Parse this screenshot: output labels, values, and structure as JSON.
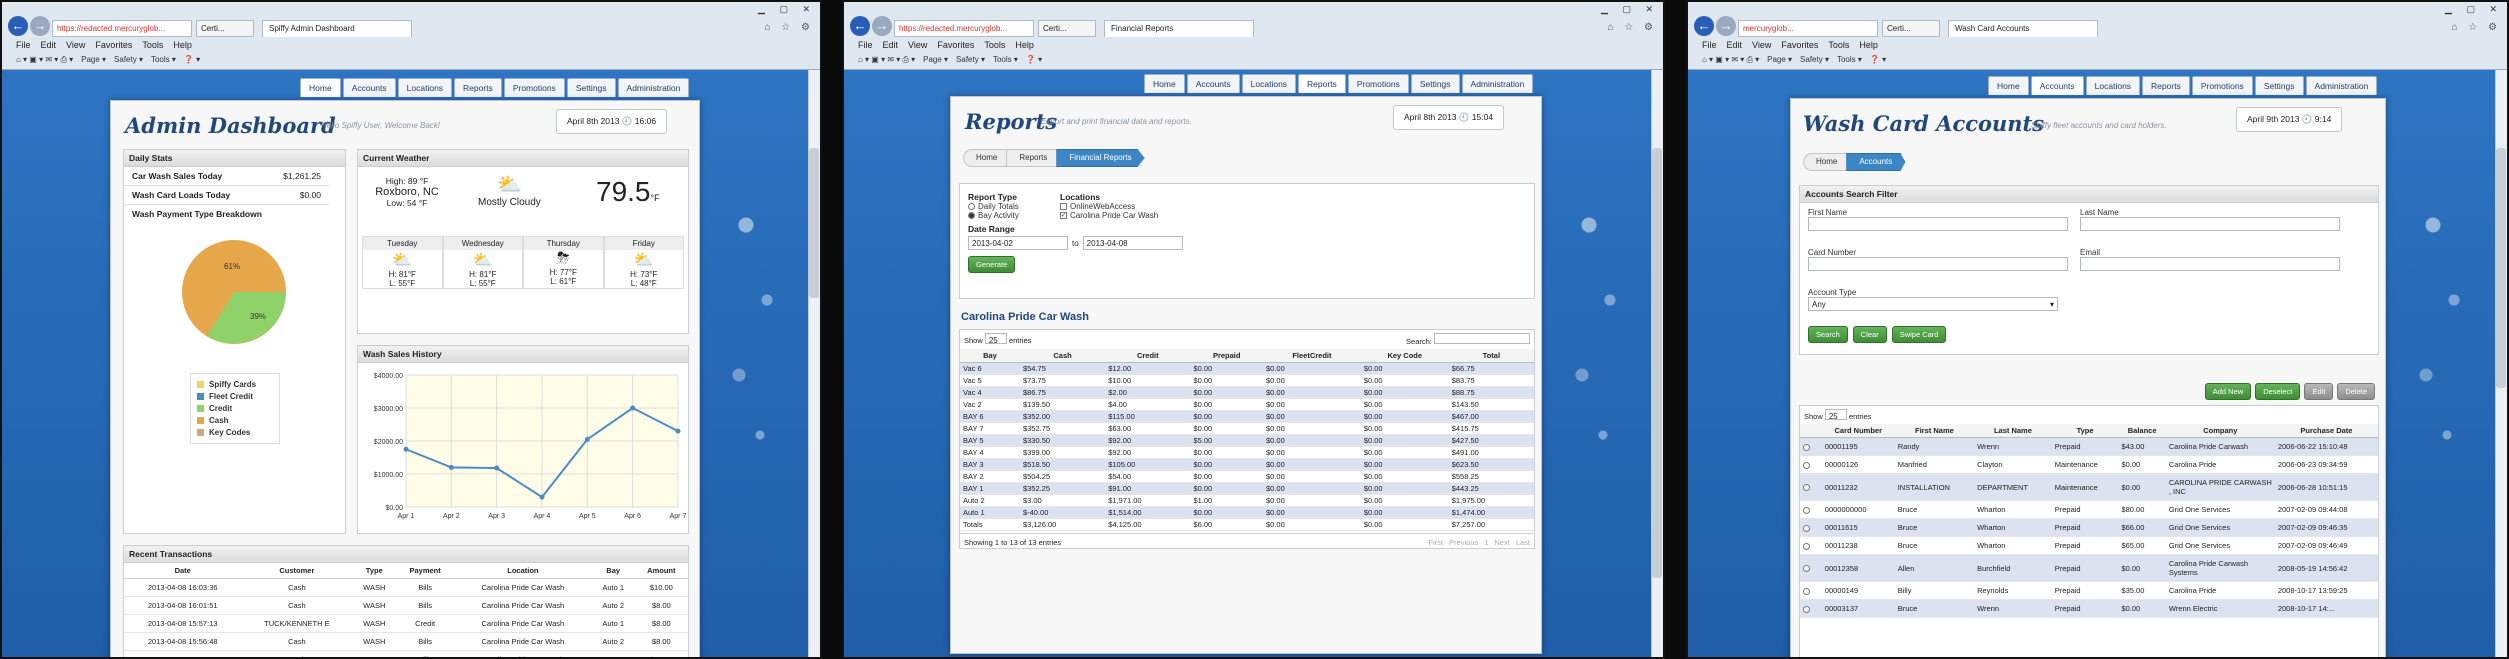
{
  "colors": {
    "accent": "#3d86c6",
    "green": "#4f9f45",
    "blue": "#4a8bc2"
  },
  "browser": {
    "w1": {
      "url": "https://redacted.mercuryglob...",
      "cert": "Certi...",
      "tab": "Spiffy Admin Dashboard"
    },
    "w2": {
      "url": "https://redacted.mercuryglob...",
      "cert": "Certi...",
      "tab": "Financial Reports"
    },
    "w3": {
      "url": "mercuryglob...",
      "cert": "Certi...",
      "tab": "Wash Card Accounts"
    },
    "menu": [
      "File",
      "Edit",
      "View",
      "Favorites",
      "Tools",
      "Help"
    ],
    "cmd": [
      "Page ▾",
      "Safety ▾",
      "Tools ▾",
      "❓ ▾"
    ]
  },
  "nav": [
    "Home",
    "Accounts",
    "Locations",
    "Reports",
    "Promotions",
    "Settings",
    "Administration"
  ],
  "dashboard": {
    "title": "Admin Dashboard",
    "subtitle": "Hello Spiffy User, Welcome Back!",
    "date": "April 8th 2013",
    "time": "16:06",
    "daily": {
      "header": "Daily Stats",
      "rows": [
        {
          "label": "Car Wash Sales Today",
          "value": "$1,261.25"
        },
        {
          "label": "Wash Card Loads Today",
          "value": "$0.00"
        }
      ],
      "breakdown": "Wash Payment Type Breakdown"
    },
    "pie": {
      "label_a": "61%",
      "label_b": "39%"
    },
    "legend": [
      "Spiffy Cards",
      "Fleet Credit",
      "Credit",
      "Cash",
      "Key Codes"
    ],
    "weather": {
      "header": "Current Weather",
      "high": "High: 89 °F",
      "city": "Roxboro, NC",
      "low": "Low: 54 °F",
      "cond": "Mostly Cloudy",
      "temp": "79.5",
      "unit": "°F",
      "days": [
        {
          "d": "Tuesday",
          "h": "H: 81°F",
          "l": "L: 55°F"
        },
        {
          "d": "Wednesday",
          "h": "H: 81°F",
          "l": "L: 55°F"
        },
        {
          "d": "Thursday",
          "h": "H: 77°F",
          "l": "L: 61°F"
        },
        {
          "d": "Friday",
          "h": "H: 73°F",
          "l": "L: 48°F"
        }
      ]
    },
    "history_header": "Wash Sales History",
    "tx": {
      "header": "Recent Transactions",
      "cols": [
        "Date",
        "Customer",
        "Type",
        "Payment",
        "Location",
        "Bay",
        "Amount"
      ],
      "rows": [
        [
          "2013-04-08 16:03:36",
          "Cash",
          "WASH",
          "Bills",
          "Carolina Pride Car Wash",
          "Auto 1",
          "$10.00"
        ],
        [
          "2013-04-08 16:01:51",
          "Cash",
          "WASH",
          "Bills",
          "Carolina Pride Car Wash",
          "Auto 2",
          "$8.00"
        ],
        [
          "2013-04-08 15:57:13",
          "TUCK/KENNETH E",
          "WASH",
          "Credit",
          "Carolina Pride Car Wash",
          "Auto 1",
          "$8.00"
        ],
        [
          "2013-04-08 15:56:48",
          "Cash",
          "WASH",
          "Bills",
          "Carolina Pride Car Wash",
          "Auto 2",
          "$8.00"
        ],
        [
          "2013-04-08 15:55:17",
          "Cash",
          "WASH",
          "Bills",
          "Carolina Pride Car Wash",
          "Auto 1",
          "$10.00"
        ]
      ]
    }
  },
  "chart_data": {
    "type": "line",
    "title": "Wash Sales History",
    "x": [
      "Apr 1",
      "Apr 2",
      "Apr 3",
      "Apr 4",
      "Apr 5",
      "Apr 6",
      "Apr 7"
    ],
    "values": [
      1750,
      1200,
      1180,
      300,
      2050,
      3000,
      2300
    ],
    "ylim": [
      0,
      4000
    ],
    "yticks": [
      "$0.00",
      "$1000.00",
      "$2000.00",
      "$3000.00",
      "$4000.00"
    ]
  },
  "reports": {
    "title": "Reports",
    "subtitle": "Export and print financial data and reports.",
    "date": "April 8th 2013",
    "time": "15:04",
    "bc": [
      "Home",
      "Reports",
      "Financial Reports"
    ],
    "rt_label": "Report Type",
    "rt": [
      "Daily Totals",
      "Bay Activity"
    ],
    "loc_label": "Locations",
    "locs": [
      "OnlineWebAccess",
      "Carolina Pride Car Wash"
    ],
    "dr_label": "Date Range",
    "from": "2013-04-02",
    "to_label": "to",
    "to": "2013-04-08",
    "generate": "Generate",
    "section": "Carolina Pride Car Wash",
    "show": "Show",
    "show_n": "25",
    "entries": "entries",
    "search": "Search:",
    "cols": [
      "Bay",
      "Cash",
      "Credit",
      "Prepaid",
      "FleetCredit",
      "Key Code",
      "Total"
    ],
    "rows": [
      [
        "Vac 6",
        "$54.75",
        "$12.00",
        "$0.00",
        "$0.00",
        "$0.00",
        "$66.75"
      ],
      [
        "Vac 5",
        "$73.75",
        "$10.00",
        "$0.00",
        "$0.00",
        "$0.00",
        "$83.75"
      ],
      [
        "Vac 4",
        "$86.75",
        "$2.00",
        "$0.00",
        "$0.00",
        "$0.00",
        "$88.75"
      ],
      [
        "Vac 2",
        "$139.50",
        "$4.00",
        "$0.00",
        "$0.00",
        "$0.00",
        "$143.50"
      ],
      [
        "BAY 6",
        "$352.00",
        "$115.00",
        "$0.00",
        "$0.00",
        "$0.00",
        "$467.00"
      ],
      [
        "BAY 7",
        "$352.75",
        "$63.00",
        "$0.00",
        "$0.00",
        "$0.00",
        "$415.75"
      ],
      [
        "BAY 5",
        "$330.50",
        "$92.00",
        "$5.00",
        "$0.00",
        "$0.00",
        "$427.50"
      ],
      [
        "BAY 4",
        "$399.00",
        "$92.00",
        "$0.00",
        "$0.00",
        "$0.00",
        "$491.00"
      ],
      [
        "BAY 3",
        "$518.50",
        "$105.00",
        "$0.00",
        "$0.00",
        "$0.00",
        "$623.50"
      ],
      [
        "BAY 2",
        "$504.25",
        "$54.00",
        "$0.00",
        "$0.00",
        "$0.00",
        "$558.25"
      ],
      [
        "BAY 1",
        "$352.25",
        "$91.00",
        "$0.00",
        "$0.00",
        "$0.00",
        "$443.25"
      ],
      [
        "Auto 2",
        "$3.00",
        "$1,971.00",
        "$1.00",
        "$0.00",
        "$0.00",
        "$1,975.00"
      ],
      [
        "Auto 1",
        "$-40.00",
        "$1,514.00",
        "$0.00",
        "$0.00",
        "$0.00",
        "$1,474.00"
      ],
      [
        "Totals",
        "$3,126.00",
        "$4,125.00",
        "$6.00",
        "$0.00",
        "$0.00",
        "$7,257.00"
      ]
    ],
    "info": "Showing 1 to 13 of 13 entries",
    "pager": [
      "First",
      "Previous",
      "1",
      "Next",
      "Last"
    ]
  },
  "wash": {
    "title": "Wash Card Accounts",
    "subtitle": "Spiffy fleet accounts and card holders.",
    "date": "April 9th 2013",
    "time": "9:14",
    "bc": [
      "Home",
      "Accounts"
    ],
    "filter": "Accounts Search Filter",
    "labels": {
      "fn": "First Name",
      "ln": "Last Name",
      "cn": "Card Number",
      "em": "Email",
      "at": "Account Type"
    },
    "at_value": "Any",
    "search": "Search",
    "clear": "Clear",
    "swipe": "Swipe Card",
    "actions": [
      "Add New",
      "Deselect",
      "Edit",
      "Delete"
    ],
    "show": "Show",
    "show_n": "25",
    "entries": "entries",
    "cols": [
      "Card Number",
      "First Name",
      "Last Name",
      "Type",
      "Balance",
      "Company",
      "Purchase Date"
    ],
    "rows": [
      [
        "00001195",
        "Randy",
        "Wrenn",
        "Prepaid",
        "$43.00",
        "Carolina Pride Carwash",
        "2006-06-22 15:10:48"
      ],
      [
        "00000126",
        "Manfried",
        "Clayton",
        "Maintenance",
        "$0.00",
        "Carolina Pride",
        "2006-06-23 09:34:59"
      ],
      [
        "00011232",
        "INSTALLATION",
        "DEPARTMENT",
        "Maintenance",
        "$0.00",
        "CAROLINA PRIDE CARWASH , INC",
        "2006-06-28 10:51:15"
      ],
      [
        "0000000000",
        "Bruce",
        "Wharton",
        "Prepaid",
        "$80.00",
        "Grid One Services",
        "2007-02-09 09:44:08"
      ],
      [
        "00011615",
        "Bruce",
        "Wharton",
        "Prepaid",
        "$66.00",
        "Grid One Services",
        "2007-02-09 09:46:35"
      ],
      [
        "00011238",
        "Bruce",
        "Wharton",
        "Prepaid",
        "$65.00",
        "Grid One Services",
        "2007-02-09 09:46:49"
      ],
      [
        "00012358",
        "Allen",
        "Burchfield",
        "Prepaid",
        "$0.00",
        "Carolina Pride Carwash Systems",
        "2008-05-19 14:56:42"
      ],
      [
        "00000149",
        "Billy",
        "Reynolds",
        "Prepaid",
        "$35.00",
        "Carolina Pride",
        "2008-10-17 13:59:25"
      ],
      [
        "00003137",
        "Bruce",
        "Wrenn",
        "Prepaid",
        "$0.00",
        "Wrenn Electric",
        "2008-10-17 14:..."
      ]
    ]
  }
}
